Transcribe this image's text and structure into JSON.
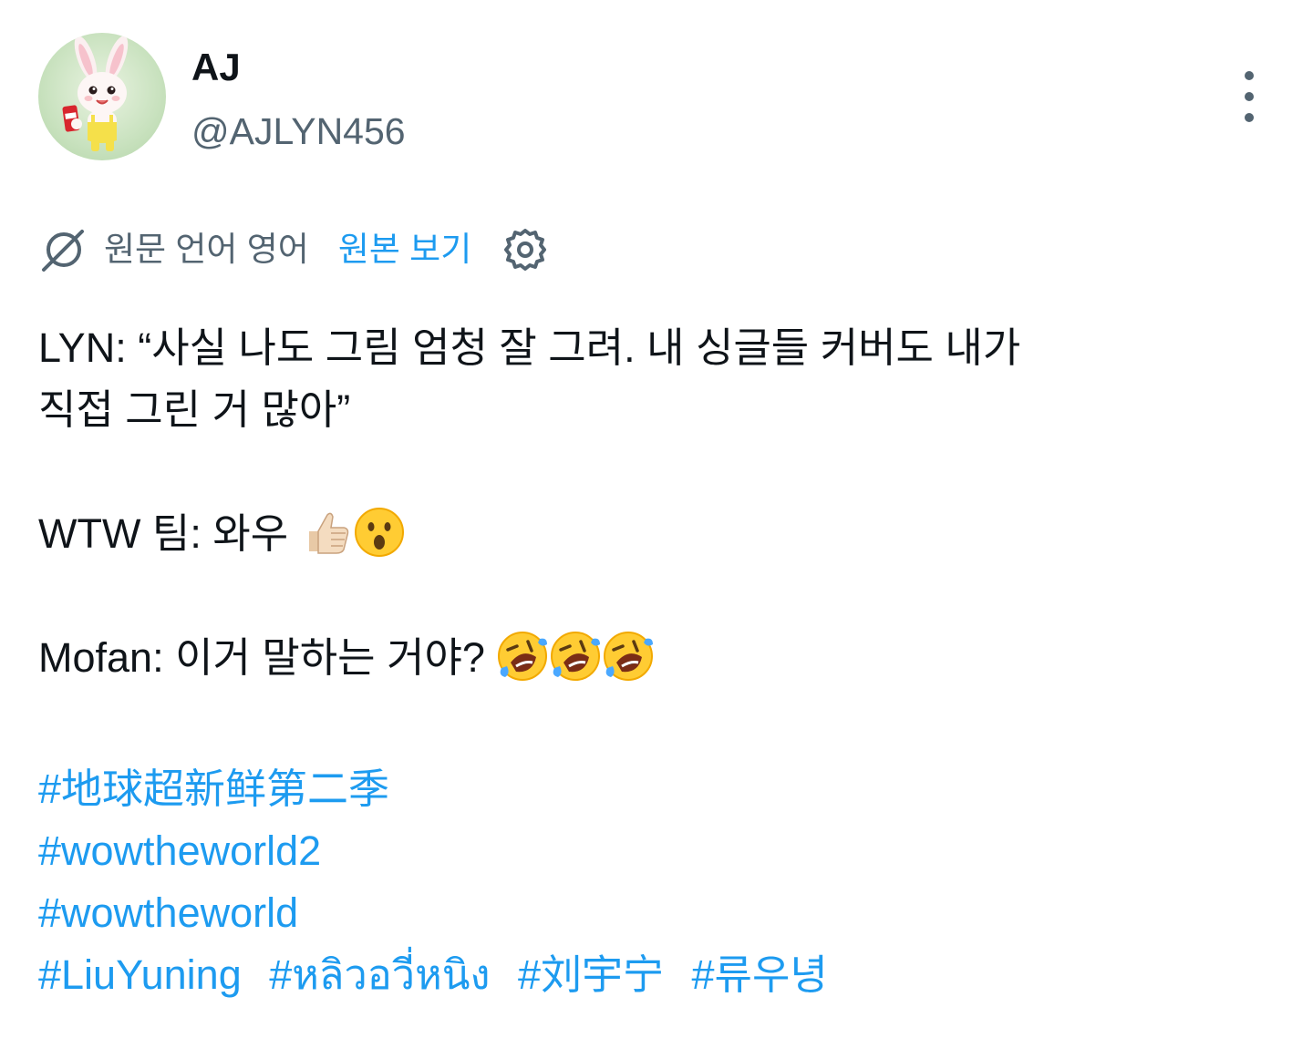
{
  "author": {
    "display_name": "AJ",
    "handle": "@AJLYN456"
  },
  "translation_bar": {
    "label": "원문 언어 영어",
    "show_original": "원본 보기"
  },
  "tweet": {
    "line1": "LYN: “사실 나도 그림 엄청 잘 그려. 내 싱글들 커버도 내가",
    "line2": "직접 그린 거 많아”",
    "line3": "WTW 팀: 와우",
    "line4": "Mofan: 이거 말하는 거야?",
    "hashtags": {
      "tag1": "#地球超新鲜第二季",
      "tag2": "#wowtheworld2",
      "tag3": "#wowtheworld",
      "tag4": "#LiuYuning",
      "tag5": "#หลิวอวี่หนิง",
      "tag6": "#刘宇宁",
      "tag7": "#류우녕"
    }
  },
  "icons": {
    "avatar": "bunny-avatar",
    "more": "more-vertical-icon",
    "translate": "globe-slash-icon",
    "settings": "gear-icon",
    "emoji_thumbs": "thumbs-up-emoji",
    "emoji_surprised": "hushed-face-emoji",
    "emoji_rofl": "rolling-on-floor-laughing-emoji"
  },
  "colors": {
    "text": "#0f1419",
    "secondary": "#536471",
    "link": "#1d9bf0"
  }
}
